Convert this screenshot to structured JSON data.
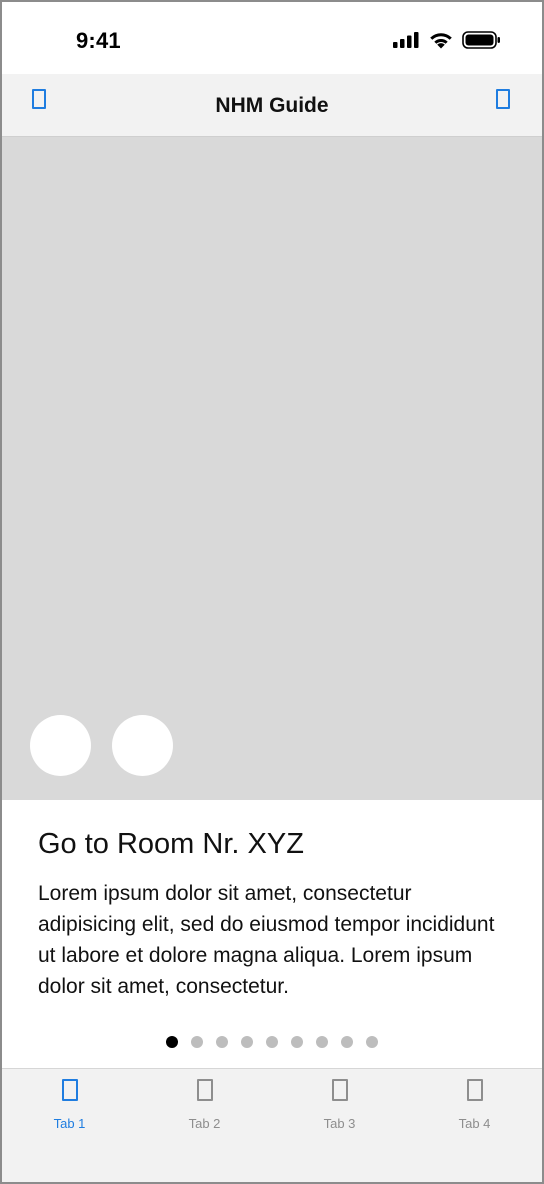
{
  "status_bar": {
    "time": "9:41",
    "icons": [
      "cellular-signal-icon",
      "wifi-icon",
      "battery-icon"
    ]
  },
  "nav_bar": {
    "title": "NHM Guide",
    "left_icon": "placeholder-icon",
    "right_icon": "placeholder-icon"
  },
  "content": {
    "title": "Go to Room Nr. XYZ",
    "body": "Lorem ipsum dolor sit amet, consectetur adipisicing elit, sed do eiusmod tempor incididunt ut labore et dolore magna aliqua. Lorem ipsum dolor sit amet, consectetur."
  },
  "pager": {
    "count": 9,
    "active_index": 0
  },
  "tab_bar": {
    "tabs": [
      {
        "label": "Tab 1",
        "active": true
      },
      {
        "label": "Tab 2",
        "active": false
      },
      {
        "label": "Tab 3",
        "active": false
      },
      {
        "label": "Tab 4",
        "active": false
      }
    ]
  },
  "colors": {
    "accent": "#1f7de0",
    "inactive": "#8e8e8e",
    "image_placeholder": "#d9d9d9",
    "bar_background": "#f2f2f2"
  }
}
